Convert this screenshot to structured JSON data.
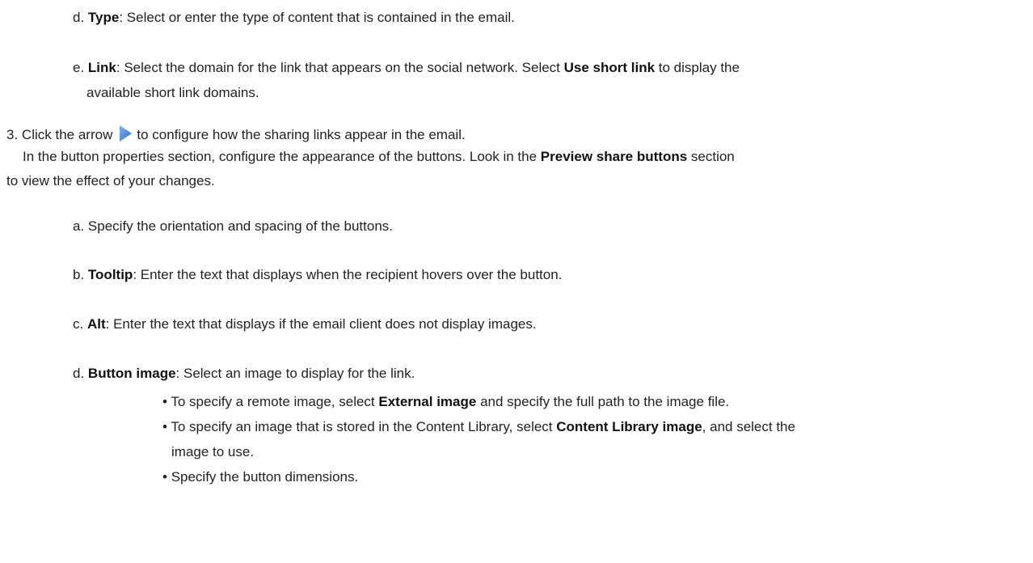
{
  "steps": {
    "d_type": {
      "marker": "d.",
      "term": "Type",
      "text": ": Select or enter the type of content that is contained in the email."
    },
    "e_link": {
      "marker": "e.",
      "term": "Link",
      "text1": ": Select the domain for the link that appears on the social network. Select ",
      "bold2": "Use short link",
      "text2": " to display the",
      "text3": "available short link domains."
    },
    "step3": {
      "marker": "3.",
      "text1": "Click the arrow",
      "text2": "to configure how the sharing links appear in the email.",
      "para1": "In the button properties section, configure the appearance of the buttons. Look in the ",
      "para_bold": "Preview share buttons",
      "para2": " section",
      "para3": "to view the effect of your changes."
    },
    "a_orient": {
      "marker": "a.",
      "text": "Specify the orientation and spacing of the buttons."
    },
    "b_tooltip": {
      "marker": "b.",
      "term": "Tooltip",
      "text": ": Enter the text that displays when the recipient hovers over the button."
    },
    "c_alt": {
      "marker": "c.",
      "term": "Alt",
      "text": ": Enter the text that displays if the email client does not display images."
    },
    "d_button": {
      "marker": "d.",
      "term": "Button image",
      "text": ": Select an image to display for the link."
    },
    "bullets": {
      "b1_pre": "To specify a remote image, select ",
      "b1_bold": "External image",
      "b1_post": " and specify the full path to the image file.",
      "b2_pre": "To specify an image that is stored in the Content Library, select ",
      "b2_bold": "Content Library image",
      "b2_post": ", and select the",
      "b2_cont": "image to use.",
      "b3": "Specify the button dimensions."
    }
  },
  "icons": {
    "arrow": "play-arrow-icon",
    "arrow_color": "#3a7bd5"
  }
}
